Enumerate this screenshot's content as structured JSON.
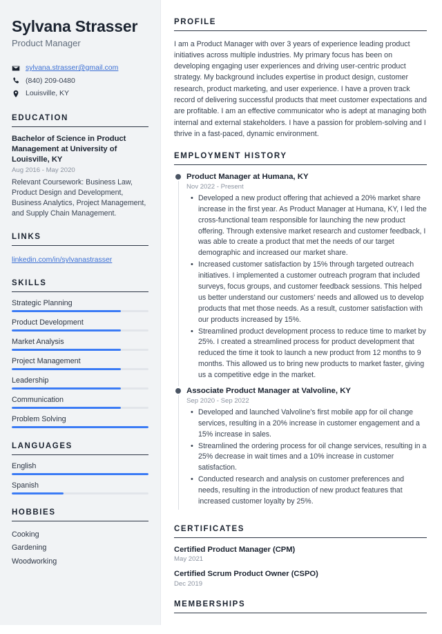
{
  "theme": {
    "sidebar_bg": "#f1f3f5",
    "accent_blue": "#3b7bf5",
    "link_blue": "#3b6fd4",
    "heading_color": "#1b2330",
    "muted_color": "#8b93a0"
  },
  "header": {
    "name": "Sylvana Strasser",
    "job_title": "Product Manager"
  },
  "contact": {
    "email": "sylvana.strasser@gmail.com",
    "email_icon": "envelope-icon",
    "phone": "(840) 209-0480",
    "phone_icon": "phone-icon",
    "location": "Louisville, KY",
    "location_icon": "map-pin-icon"
  },
  "sidebar": {
    "education": {
      "heading": "EDUCATION",
      "items": [
        {
          "title": "Bachelor of Science in Product Management at University of Louisville, KY",
          "date": "Aug 2016 - May 2020",
          "description": "Relevant Coursework: Business Law, Product Design and Development, Business Analytics, Project Management, and Supply Chain Management."
        }
      ]
    },
    "links": {
      "heading": "LINKS",
      "items": [
        {
          "label": "linkedin.com/in/sylvanastrasser"
        }
      ]
    },
    "skills": {
      "heading": "SKILLS",
      "items": [
        {
          "label": "Strategic Planning",
          "level": 80
        },
        {
          "label": "Product Development",
          "level": 80
        },
        {
          "label": "Market Analysis",
          "level": 80
        },
        {
          "label": "Project Management",
          "level": 80
        },
        {
          "label": "Leadership",
          "level": 80
        },
        {
          "label": "Communication",
          "level": 80
        },
        {
          "label": "Problem Solving",
          "level": 100
        }
      ]
    },
    "languages": {
      "heading": "LANGUAGES",
      "items": [
        {
          "label": "English",
          "level": 100
        },
        {
          "label": "Spanish",
          "level": 38
        }
      ]
    },
    "hobbies": {
      "heading": "HOBBIES",
      "items": [
        {
          "label": "Cooking"
        },
        {
          "label": "Gardening"
        },
        {
          "label": "Woodworking"
        }
      ]
    }
  },
  "main": {
    "profile": {
      "heading": "PROFILE",
      "text": "I am a Product Manager with over 3 years of experience leading product initiatives across multiple industries. My primary focus has been on developing engaging user experiences and driving user-centric product strategy. My background includes expertise in product design, customer research, product marketing, and user experience. I have a proven track record of delivering successful products that meet customer expectations and are profitable. I am an effective communicator who is adept at managing both internal and external stakeholders. I have a passion for problem-solving and I thrive in a fast-paced, dynamic environment."
    },
    "employment": {
      "heading": "EMPLOYMENT HISTORY",
      "entries": [
        {
          "title": "Product Manager at Humana, KY",
          "date": "Nov 2022 - Present",
          "bullets": [
            "Developed a new product offering that achieved a 20% market share increase in the first year. As Product Manager at Humana, KY, I led the cross-functional team responsible for launching the new product offering. Through extensive market research and customer feedback, I was able to create a product that met the needs of our target demographic and increased our market share.",
            "Increased customer satisfaction by 15% through targeted outreach initiatives. I implemented a customer outreach program that included surveys, focus groups, and customer feedback sessions. This helped us better understand our customers' needs and allowed us to develop products that met those needs. As a result, customer satisfaction with our products increased by 15%.",
            "Streamlined product development process to reduce time to market by 25%. I created a streamlined process for product development that reduced the time it took to launch a new product from 12 months to 9 months. This allowed us to bring new products to market faster, giving us a competitive edge in the market."
          ]
        },
        {
          "title": "Associate Product Manager at Valvoline, KY",
          "date": "Sep 2020 - Sep 2022",
          "bullets": [
            "Developed and launched Valvoline's first mobile app for oil change services, resulting in a 20% increase in customer engagement and a 15% increase in sales.",
            "Streamlined the ordering process for oil change services, resulting in a 25% decrease in wait times and a 10% increase in customer satisfaction.",
            "Conducted research and analysis on customer preferences and needs, resulting in the introduction of new product features that increased customer loyalty by 25%."
          ]
        }
      ]
    },
    "certificates": {
      "heading": "CERTIFICATES",
      "items": [
        {
          "title": "Certified Product Manager (CPM)",
          "date": "May 2021"
        },
        {
          "title": "Certified Scrum Product Owner (CSPO)",
          "date": "Dec 2019"
        }
      ]
    },
    "memberships": {
      "heading": "MEMBERSHIPS"
    }
  }
}
